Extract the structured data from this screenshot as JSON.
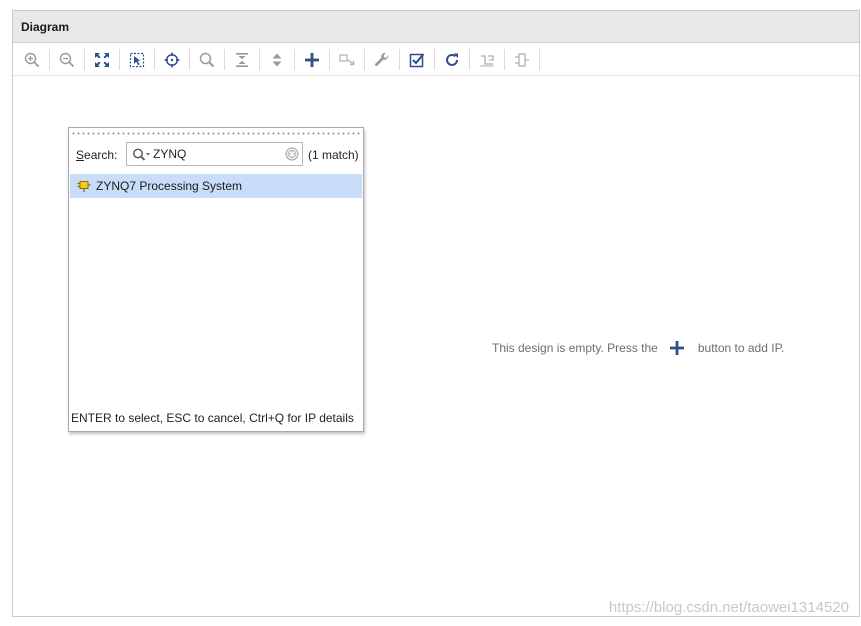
{
  "panel": {
    "title": "Diagram"
  },
  "toolbar": {
    "buttons": [
      {
        "icon": "zoom-in-icon"
      },
      {
        "icon": "zoom-out-icon"
      },
      {
        "icon": "zoom-fit-icon"
      },
      {
        "icon": "zoom-area-icon"
      },
      {
        "icon": "autoconnect-target-icon"
      },
      {
        "icon": "search-icon"
      },
      {
        "icon": "collapse-icon"
      },
      {
        "icon": "expand-icon"
      },
      {
        "icon": "add-ip-icon"
      },
      {
        "icon": "make-external-icon"
      },
      {
        "icon": "properties-wrench-icon"
      },
      {
        "icon": "validate-design-icon"
      },
      {
        "icon": "regenerate-layout-icon"
      },
      {
        "icon": "optimize-routing-icon"
      },
      {
        "icon": "block-icon"
      }
    ]
  },
  "canvas": {
    "empty_msg_before": "This design is empty. Press the",
    "empty_msg_after": "button to add IP.",
    "watermark": "https://blog.csdn.net/taowei1314520"
  },
  "ip_search": {
    "label_mnemonic": "S",
    "label_rest": "earch:",
    "query": "ZYNQ",
    "match_count": "(1 match)",
    "results": [
      {
        "name": "ZYNQ7 Processing System",
        "selected": true
      }
    ],
    "footer": "ENTER to select, ESC to cancel, Ctrl+Q for IP details"
  },
  "colors": {
    "accent": "#2e4f8a",
    "selection": "#c8ddf7",
    "icon_gray": "#9a9a9a",
    "ip_yellow": "#e6c200"
  }
}
